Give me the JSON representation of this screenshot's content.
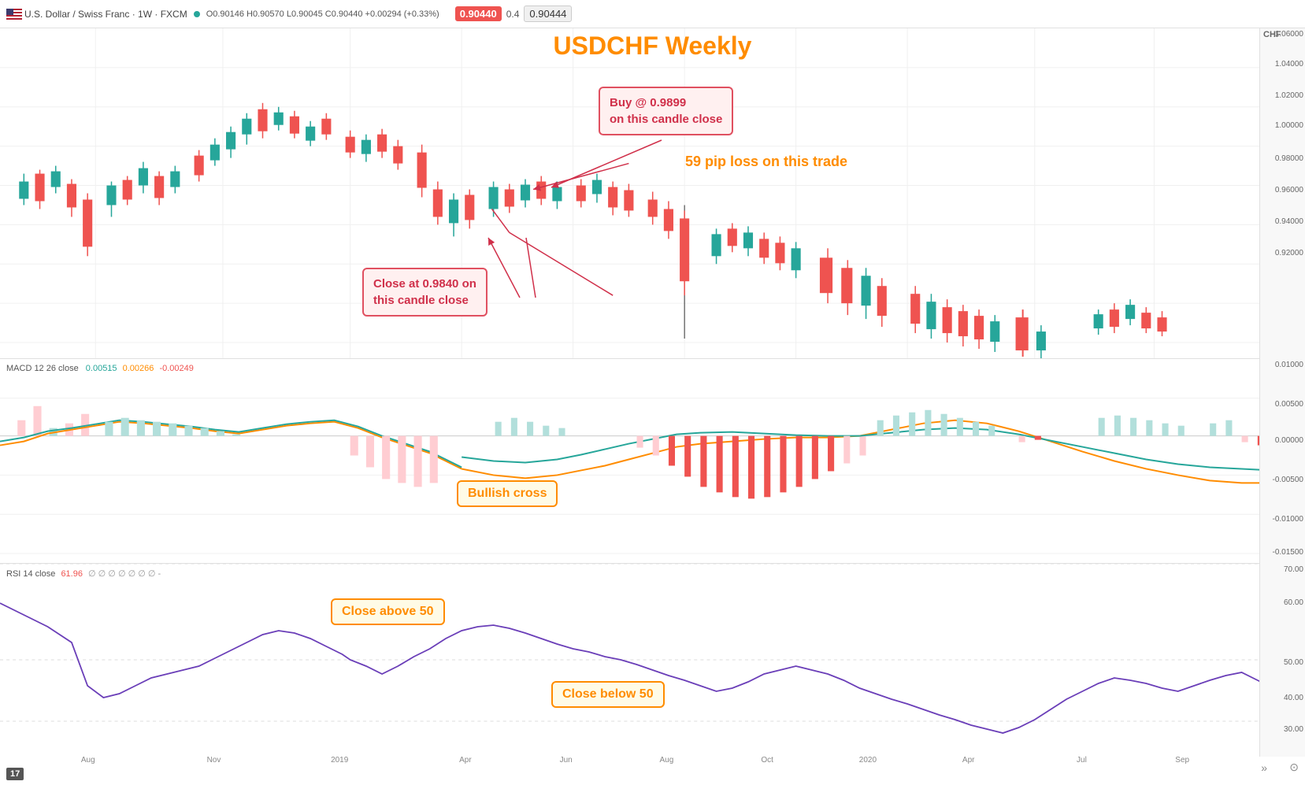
{
  "header": {
    "symbol": "U.S. Dollar / Swiss Franc · 1W · FXCM",
    "dot_color": "#26a69a",
    "ohlc": "O0.90146 H0.90570 L0.90045 C0.90440 +0.00294 (+0.33%)",
    "price_badge": "0.90440",
    "price_value": "0.90444",
    "multiplier": "0.4"
  },
  "chart": {
    "title": "USDCHF Weekly",
    "currency": "CHF",
    "right_axis_labels": [
      {
        "value": "1.06000",
        "offset_pct": 2
      },
      {
        "value": "1.04000",
        "offset_pct": 10
      },
      {
        "value": "1.02000",
        "offset_pct": 19
      },
      {
        "value": "1.00000",
        "offset_pct": 28
      },
      {
        "value": "0.98000",
        "offset_pct": 37
      },
      {
        "value": "0.96000",
        "offset_pct": 46
      },
      {
        "value": "0.94000",
        "offset_pct": 55
      },
      {
        "value": "0.92000",
        "offset_pct": 64
      }
    ]
  },
  "annotations": {
    "buy": "Buy @ 0.9899\non this candle close",
    "close": "Close at 0.9840 on\nthis candle close",
    "pip_loss": "59 pip loss on this trade",
    "bullish_cross": "Bullish cross",
    "close_above": "Close above 50",
    "close_below": "Close below 50"
  },
  "macd": {
    "label": "MACD 12 26 close",
    "value1": "0.00515",
    "value2": "0.00266",
    "value3": "-0.00249",
    "color1": "#26a69a",
    "color2": "#ff8c00",
    "color3": "#ef5350",
    "right_labels": [
      {
        "value": "0.01000",
        "pct": 2
      },
      {
        "value": "0.00500",
        "pct": 20
      },
      {
        "value": "0.00000",
        "pct": 38
      },
      {
        "value": "-0.00500",
        "pct": 57
      },
      {
        "value": "-0.01000",
        "pct": 76
      },
      {
        "value": "-0.01500",
        "pct": 94
      }
    ]
  },
  "rsi": {
    "label": "RSI 14 close",
    "value": "61.96",
    "indicators": "∅ ∅ ∅ ∅ ∅ ∅ ∅ -",
    "right_labels": [
      {
        "value": "70.00",
        "pct": 8
      },
      {
        "value": "60.00",
        "pct": 26
      },
      {
        "value": "50.00",
        "pct": 50
      },
      {
        "value": "40.00",
        "pct": 68
      },
      {
        "value": "30.00",
        "pct": 86
      }
    ],
    "level_70_pct": 15,
    "level_50_pct": 50,
    "level_30_pct": 82
  },
  "x_axis": {
    "labels": [
      "Aug",
      "Nov",
      "2019",
      "Apr",
      "Jun",
      "Aug",
      "Oct",
      "2020",
      "Apr",
      "Jul",
      "Sep"
    ]
  },
  "branding": {
    "logo": "17",
    "chevron": "»",
    "settings": "⊙"
  }
}
